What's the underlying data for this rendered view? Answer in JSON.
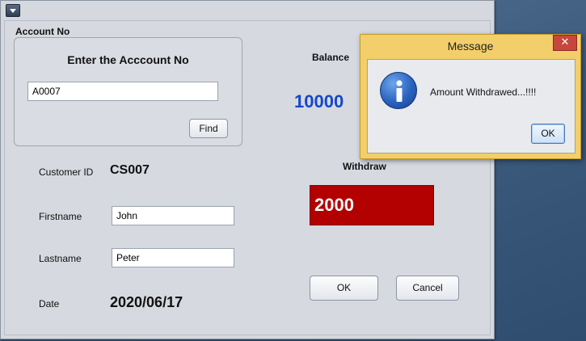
{
  "form": {
    "section_title": "Account No",
    "group_heading": "Enter the Acccount No",
    "account_input_value": "A0007",
    "find_label": "Find",
    "balance_label": "Balance",
    "balance_value": "10000",
    "customer_id_label": "Customer ID",
    "customer_id_value": "CS007",
    "withdraw_label": "Withdraw",
    "withdraw_value": "2000",
    "firstname_label": "Firstname",
    "firstname_value": "John",
    "lastname_label": "Lastname",
    "lastname_value": "Peter",
    "date_label": "Date",
    "date_value": "2020/06/17",
    "ok_label": "OK",
    "cancel_label": "Cancel"
  },
  "dialog": {
    "title": "Message",
    "message": "Amount Withdrawed...!!!!",
    "ok_label": "OK",
    "close_glyph": "✕",
    "icon": "information-icon"
  },
  "colors": {
    "balance_text": "#1447c8",
    "withdraw_bg": "#b30000",
    "dialog_frame": "#f2cf6a"
  }
}
